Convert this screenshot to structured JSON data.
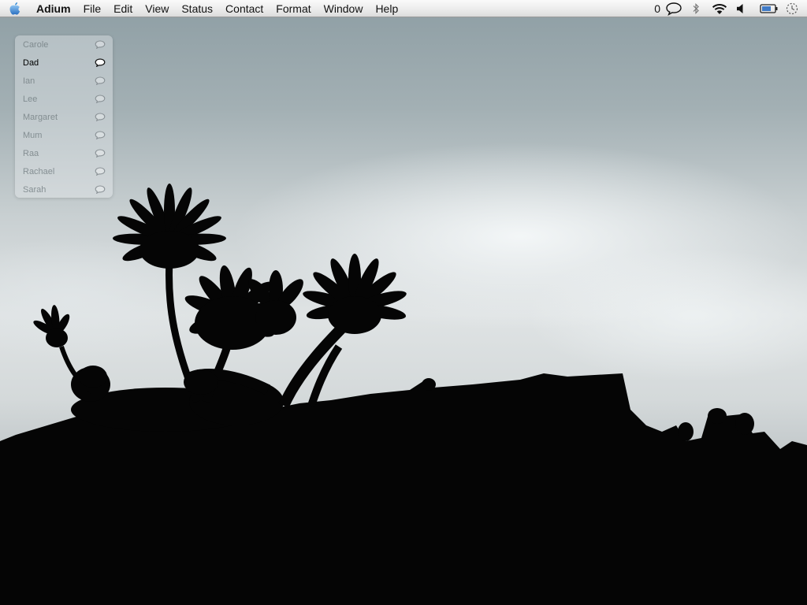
{
  "menubar": {
    "apple_icon": "apple-icon",
    "app_name": "Adium",
    "items": [
      "File",
      "Edit",
      "View",
      "Status",
      "Contact",
      "Format",
      "Window",
      "Help"
    ],
    "unread_count": "0",
    "extras": [
      "speech-bubble-icon",
      "bluetooth-icon",
      "wifi-icon",
      "volume-icon",
      "battery-icon",
      "sync-clock-icon"
    ]
  },
  "contacts": [
    {
      "name": "Carole",
      "online": false
    },
    {
      "name": "Dad",
      "online": true
    },
    {
      "name": "Ian",
      "online": false
    },
    {
      "name": "Lee",
      "online": false
    },
    {
      "name": "Margaret",
      "online": false
    },
    {
      "name": "Mum",
      "online": false
    },
    {
      "name": "Raa",
      "online": false
    },
    {
      "name": "Rachael",
      "online": false
    },
    {
      "name": "Sarah",
      "online": false
    }
  ],
  "colors": {
    "menubar": "#ececec",
    "apple_blue": "#3a8fd8",
    "sky": "#c9d0d2",
    "silhouette": "#050505"
  }
}
